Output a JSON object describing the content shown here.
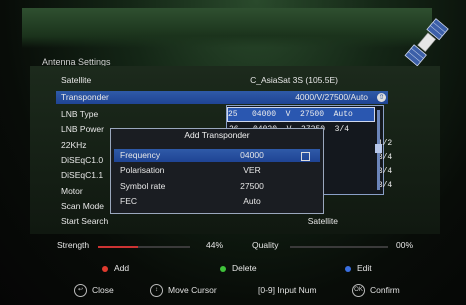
{
  "window": {
    "title": "Antenna Settings"
  },
  "settings": [
    {
      "label": "Satellite",
      "value": "C_AsiaSat 3S (105.5E)"
    },
    {
      "label": "Transponder",
      "value": "4000/V/27500/Auto"
    },
    {
      "label": "LNB Type",
      "value": ""
    },
    {
      "label": "LNB Power",
      "value": ""
    },
    {
      "label": "22KHz",
      "value": ""
    },
    {
      "label": "DiSEqC1.0",
      "value": ""
    },
    {
      "label": "DiSEqC1.1",
      "value": ""
    },
    {
      "label": "Motor",
      "value": ""
    },
    {
      "label": "Scan Mode",
      "value": ""
    },
    {
      "label": "Start Search",
      "value": "Satellite"
    }
  ],
  "transponder_list": [
    "25   04000  V  27500  Auto",
    "26   04020  V  27250  3/4",
    "                               1/2",
    "                               3/4",
    "                               3/4",
    "                               3/4"
  ],
  "dialog": {
    "title": "Add Transponder",
    "fields": [
      {
        "label": "Frequency",
        "value": "04000"
      },
      {
        "label": "Polarisation",
        "value": "VER"
      },
      {
        "label": "Symbol rate",
        "value": "27500"
      },
      {
        "label": "FEC",
        "value": "Auto"
      }
    ]
  },
  "signal": {
    "strength_label": "Strength",
    "strength_value": "44%",
    "strength_fraction": 0.44,
    "quality_label": "Quality",
    "quality_value": "00%",
    "quality_fraction": 0.0
  },
  "color_keys": [
    {
      "label": "Add",
      "color": "#e03a2e"
    },
    {
      "label": "Delete",
      "color": "#3fc23a"
    },
    {
      "label": "Edit",
      "color": "#3a6fe0"
    }
  ],
  "footer": {
    "close": "Close",
    "move_cursor": "Move Cursor",
    "input_num_key": "[0-9]",
    "input_num": "Input Num",
    "confirm": "Confirm"
  }
}
